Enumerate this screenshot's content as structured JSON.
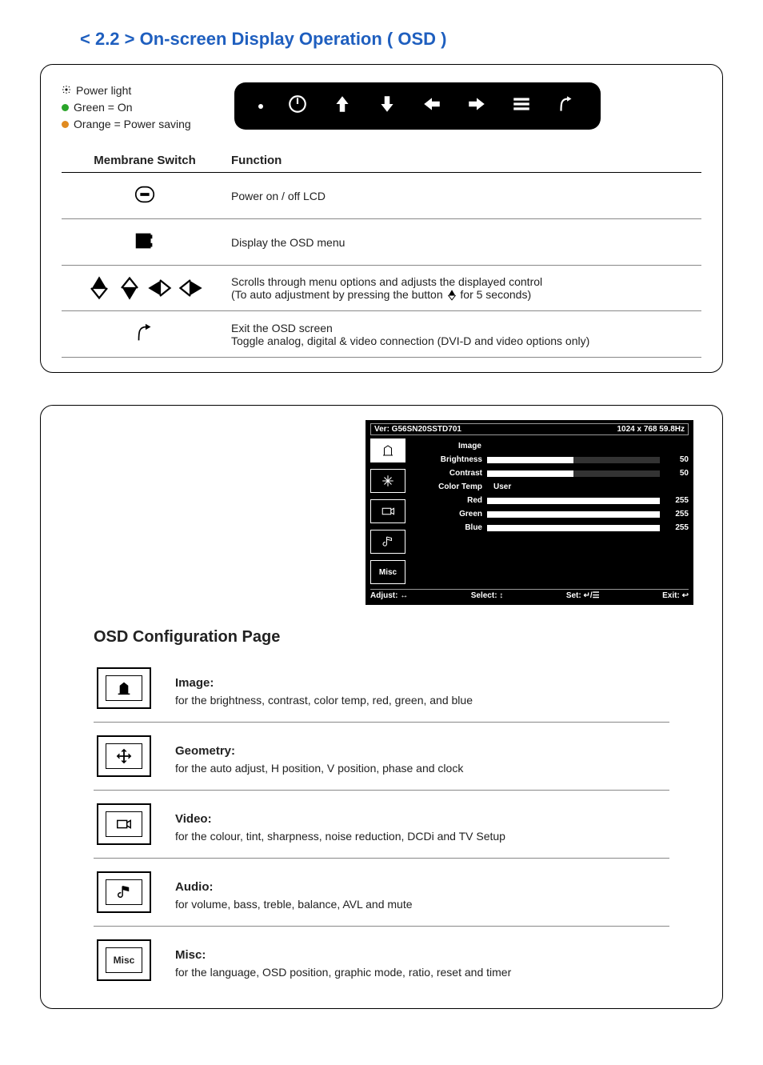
{
  "header": {
    "title": "< 2.2 > On-screen Display Operation ( OSD )"
  },
  "legend": {
    "power_light": "Power light",
    "green": "Green = On",
    "orange": "Orange = Power saving",
    "green_color": "#2aa52a",
    "orange_color": "#e08a1f"
  },
  "table": {
    "col_switch": "Membrane Switch",
    "col_function": "Function",
    "rows": [
      {
        "fn": "Power on / off LCD"
      },
      {
        "fn": "Display the OSD menu"
      },
      {
        "fn_line1": "Scrolls through menu options and adjusts the displayed control",
        "fn_line2a": "(To auto adjustment by pressing the button ",
        "fn_line2b": " for 5 seconds)"
      },
      {
        "fn_line1": "Exit the OSD screen",
        "fn_line2": "Toggle analog, digital & video connection (DVI-D and video options only)"
      }
    ]
  },
  "osd_screenshot": {
    "ver_label": "Ver: G56SN20SSTD701",
    "res_label": "1024 x 768  59.8Hz",
    "heading": "Image",
    "rows": [
      {
        "lbl": "Brightness",
        "val": "50",
        "pct": 50
      },
      {
        "lbl": "Contrast",
        "val": "50",
        "pct": 50
      },
      {
        "lbl": "Color Temp",
        "val": "User",
        "pct": null
      },
      {
        "lbl": "Red",
        "val": "255",
        "pct": 100
      },
      {
        "lbl": "Green",
        "val": "255",
        "pct": 100
      },
      {
        "lbl": "Blue",
        "val": "255",
        "pct": 100
      }
    ],
    "misc_label": "Misc",
    "bottom": {
      "adjust": "Adjust: ↔",
      "select": "Select: ↕",
      "set": "Set: ↵/☰",
      "exit": "Exit: ↩"
    }
  },
  "config": {
    "title": "OSD Configuration Page",
    "items": [
      {
        "name": "Image:",
        "desc": "for the brightness, contrast, color temp, red, green, and blue"
      },
      {
        "name": "Geometry:",
        "desc": "for the auto adjust, H position, V position, phase and clock"
      },
      {
        "name": "Video:",
        "desc": "for the colour, tint, sharpness, noise reduction, DCDi and TV Setup"
      },
      {
        "name": "Audio:",
        "desc": "for volume, bass, treble, balance, AVL and mute"
      },
      {
        "name": "Misc:",
        "desc": "for the language, OSD position, graphic mode, ratio, reset and timer",
        "misc_label": "Misc"
      }
    ]
  }
}
